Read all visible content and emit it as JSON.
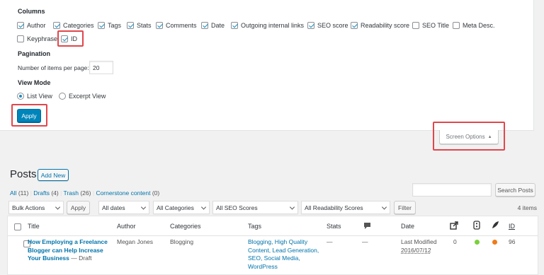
{
  "screen_options": {
    "columns_heading": "Columns",
    "columns": [
      {
        "label": "Author",
        "checked": true
      },
      {
        "label": "Categories",
        "checked": true
      },
      {
        "label": "Tags",
        "checked": true
      },
      {
        "label": "Stats",
        "checked": true
      },
      {
        "label": "Comments",
        "checked": true
      },
      {
        "label": "Date",
        "checked": true
      },
      {
        "label": "Outgoing internal links",
        "checked": true
      },
      {
        "label": "SEO score",
        "checked": true
      },
      {
        "label": "Readability score",
        "checked": true
      },
      {
        "label": "SEO Title",
        "checked": false
      },
      {
        "label": "Meta Desc.",
        "checked": false
      },
      {
        "label": "Keyphrase",
        "checked": false
      },
      {
        "label": "ID",
        "checked": true
      }
    ],
    "pagination_heading": "Pagination",
    "items_per_page_label": "Number of items per page:",
    "items_per_page_value": "20",
    "view_mode_heading": "View Mode",
    "view_modes": [
      {
        "label": "List View",
        "selected": true
      },
      {
        "label": "Excerpt View",
        "selected": false
      }
    ],
    "apply_label": "Apply",
    "toggle_label": "Screen Options"
  },
  "posts": {
    "title": "Posts",
    "add_new_label": "Add New",
    "filters": {
      "all": "All",
      "all_count": "(11)",
      "drafts": "Drafts",
      "drafts_count": "(4)",
      "trash": "Trash",
      "trash_count": "(26)",
      "cornerstone": "Cornerstone content",
      "cornerstone_count": "(0)",
      "sep": "|"
    },
    "search_button_label": "Search Posts",
    "search_value": "",
    "bulk_actions": "Bulk Actions",
    "bulk_apply_label": "Apply",
    "dates_filter": "All dates",
    "categories_filter": "All Categories",
    "seo_filter": "All SEO Scores",
    "readability_filter": "All Readability Scores",
    "filter_button_label": "Filter",
    "item_count": "4 items",
    "table": {
      "headers": {
        "title": "Title",
        "author": "Author",
        "categories": "Categories",
        "tags": "Tags",
        "stats": "Stats",
        "date": "Date",
        "id": "ID"
      },
      "row": {
        "title_line1": "How Employing a Freelance",
        "title_line2": "Blogger can Help Increase",
        "title_line3": "Your Business",
        "draft_suffix": "— Draft",
        "author": "Megan Jones",
        "category": "Blogging",
        "tags_line1": "Blogging, High Quality",
        "tags_line2": "Content, Lead Generation,",
        "tags_line3": "SEO, Social Media,",
        "tags_line4": "WordPress",
        "stats": "—",
        "comments": "—",
        "date_status": "Last Modified",
        "date_value": "2016/07/12",
        "links_count": "0",
        "seo_color": "#7ad03a",
        "readability_color": "#ee7c1b",
        "id": "96"
      }
    }
  },
  "colors": {
    "highlight": "#e0474c",
    "primary": "#0085ba",
    "link": "#0073aa"
  }
}
